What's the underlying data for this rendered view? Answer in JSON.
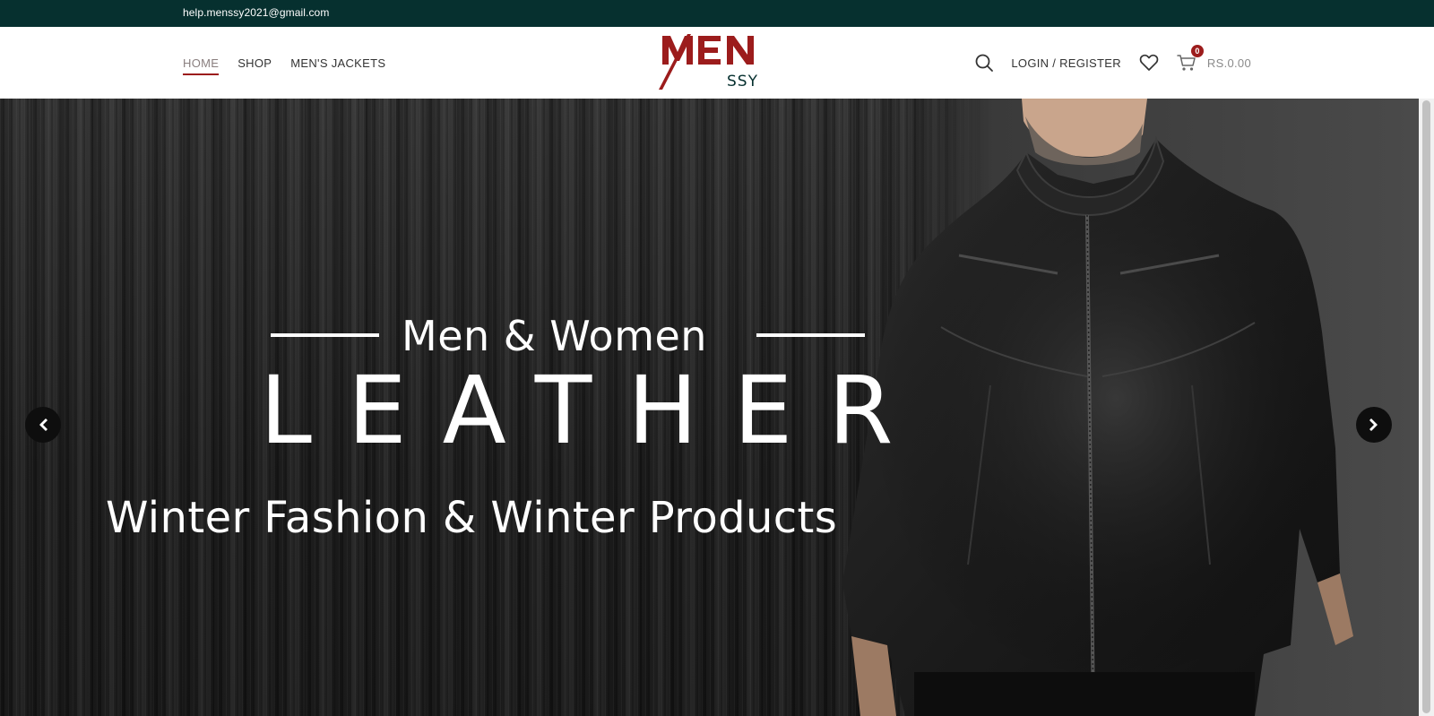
{
  "topbar": {
    "email": "help.menssy2021@gmail.com"
  },
  "nav": {
    "items": [
      {
        "label": "HOME",
        "active": true
      },
      {
        "label": "SHOP",
        "active": false
      },
      {
        "label": "MEN'S JACKETS",
        "active": false
      }
    ]
  },
  "logo": {
    "main": "MEN",
    "sub": "SSY",
    "color": "#9c1c1c",
    "sub_color": "#06302f"
  },
  "header_actions": {
    "search_icon": "search-icon",
    "login_label": "LOGIN / REGISTER",
    "wishlist_icon": "heart-icon",
    "cart_icon": "cart-icon",
    "cart_count": "0",
    "cart_total": "RS.0.00"
  },
  "hero": {
    "eyebrow": "Men & Women",
    "headline": "LEATHER",
    "subline": "Winter  Fashion & Winter Products",
    "prev_icon": "chevron-left-icon",
    "next_icon": "chevron-right-icon"
  },
  "colors": {
    "topbar": "#06302f",
    "accent": "#9c1c1c"
  }
}
